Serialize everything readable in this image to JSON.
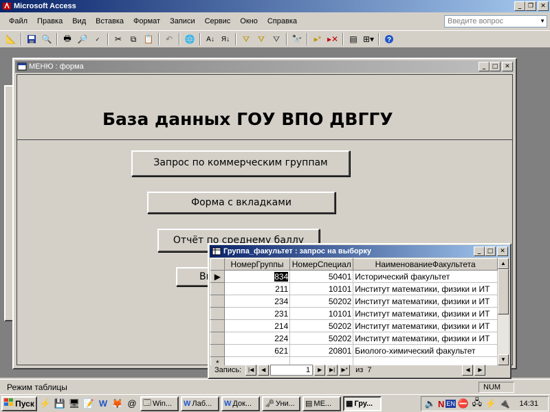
{
  "app": {
    "title": "Microsoft Access",
    "ask_placeholder": "Введите вопрос"
  },
  "menu": [
    "Файл",
    "Правка",
    "Вид",
    "Вставка",
    "Формат",
    "Записи",
    "Сервис",
    "Окно",
    "Справка"
  ],
  "toolbar": {
    "icons": [
      "design-view-icon",
      "save-icon",
      "search-file-icon",
      "print-icon",
      "print-preview-icon",
      "spelling-icon",
      "cut-icon",
      "copy-icon",
      "paste-icon",
      "undo-icon",
      "hyperlink-icon",
      "sort-asc-icon",
      "sort-desc-icon",
      "filter-selection-icon",
      "filter-form-icon",
      "apply-filter-icon",
      "find-icon",
      "new-record-icon",
      "delete-record-icon",
      "properties-icon",
      "new-object-icon",
      "help-icon"
    ]
  },
  "menu_form": {
    "title": "МЕНЮ : форма",
    "heading": "База данных ГОУ ВПО ДВГГУ",
    "buttons": {
      "query": "Запрос по коммерческим группам",
      "tabs": "Форма с вкладками",
      "report": "Отчёт по среднему баллу",
      "exit": "Вы"
    }
  },
  "query_window": {
    "title": "Группа_факультет : запрос на выборку",
    "columns": [
      "НомерГруппы",
      "НомерСпециал",
      "НаименованиеФакультета"
    ],
    "rows": [
      [
        "834",
        "50401",
        "Исторический факультет"
      ],
      [
        "211",
        "10101",
        "Институт математики, физики и ИТ"
      ],
      [
        "234",
        "50202",
        "Институт математики, физики и ИТ"
      ],
      [
        "231",
        "10101",
        "Институт математики, физики и ИТ"
      ],
      [
        "214",
        "50202",
        "Институт математики, физики и ИТ"
      ],
      [
        "224",
        "50202",
        "Институт математики, физики и ИТ"
      ],
      [
        "621",
        "20801",
        "Биолого-химический факультет"
      ]
    ],
    "new_row_marker": "*",
    "nav": {
      "label": "Запись:",
      "current": "1",
      "of_label": "из",
      "total": "7"
    }
  },
  "status": {
    "text": "Режим таблицы",
    "num": "NUM"
  },
  "taskbar": {
    "start": "Пуск",
    "tasks": [
      "Win...",
      "Лаб...",
      "Док...",
      "Уни...",
      "МЕ...",
      "Гру..."
    ],
    "clock": "14:31",
    "lang": "EN"
  }
}
